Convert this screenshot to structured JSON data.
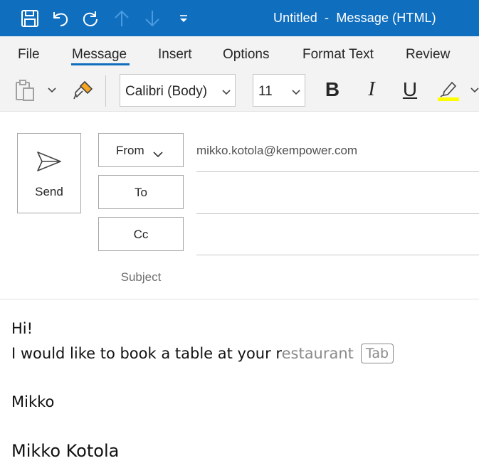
{
  "titlebar": {
    "title": "Untitled  -  Message (HTML)",
    "icons": [
      "save-icon",
      "undo-icon",
      "redo-icon",
      "up-arrow-icon",
      "down-arrow-icon",
      "customize-qat-icon"
    ]
  },
  "ribbon": {
    "tabs": [
      "File",
      "Message",
      "Insert",
      "Options",
      "Format Text",
      "Review"
    ],
    "active_tab": "Message"
  },
  "toolbar": {
    "font_name": "Calibri (Body)",
    "font_size": "11",
    "bold_label": "B",
    "italic_label": "I",
    "underline_label": "U",
    "highlight_color": "#ffff00"
  },
  "header": {
    "send_label": "Send",
    "from_label": "From",
    "from_value": "mikko.kotola@kempower.com",
    "to_label": "To",
    "cc_label": "Cc",
    "subject_label": "Subject"
  },
  "body": {
    "line1": "Hi!",
    "line2_typed": "I would like to book a table at your r",
    "line2_suggestion": "estaurant",
    "suggestion_hint": "Tab",
    "line3": "Mikko",
    "signature": "Mikko Kotola"
  },
  "colors": {
    "titlebar": "#106ebe",
    "ribbon_bg": "#f3f3f3",
    "accent": "#106ebe"
  }
}
